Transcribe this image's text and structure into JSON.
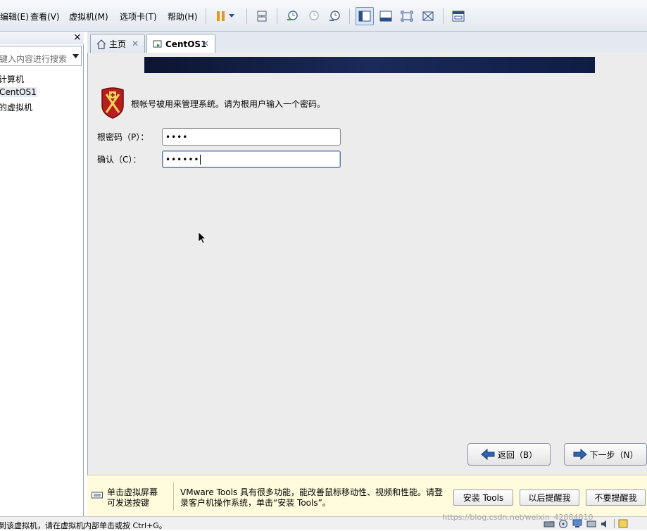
{
  "menubar": {
    "items": [
      "编辑(E)",
      "查看(V)",
      "虚拟机(M)",
      "选项卡(T)",
      "帮助(H)"
    ]
  },
  "sidebar": {
    "close_label": "×",
    "search_placeholder": "键入内容进行搜索",
    "tree": [
      "计算机",
      "CentOS1",
      "的虚拟机"
    ]
  },
  "tabs": [
    {
      "label": "主页",
      "icon": "home-icon"
    },
    {
      "label": "CentOS1",
      "icon": "vm-icon"
    }
  ],
  "installer": {
    "message": "根帐号被用来管理系统。请为根用户输入一个密码。",
    "root_password_label": "根密码（P）：",
    "root_password_value": "••••",
    "confirm_label": "确认（C）：",
    "confirm_value": "••••••",
    "back_button": "返回（B）",
    "next_button": "下一步（N）"
  },
  "notification": {
    "hint": [
      "单击虚拟屏幕",
      "可发送按键"
    ],
    "message": [
      "VMware Tools 具有很多功能，能改善鼠标移动性、视频和性能。请登",
      "录客户机操作系统，单击“安装 Tools”。"
    ],
    "install_button": "安装 Tools",
    "remind_button": "以后提醒我",
    "no_remind_button": "不要提醒我"
  },
  "statusbar": {
    "text": "到该虚拟机，请在虚拟机内部单击或按 Ctrl+G。",
    "watermark": "https://blog.csdn.net/weixin_42884810"
  }
}
